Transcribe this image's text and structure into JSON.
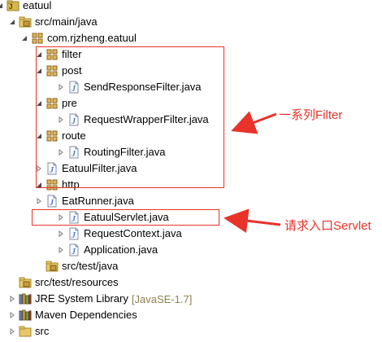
{
  "tree": [
    {
      "label": "eatuul",
      "icon": "project-icon",
      "toggle": "expanded",
      "interactable": true
    },
    {
      "label": "src/main/java",
      "icon": "source-folder-icon",
      "toggle": "expanded",
      "interactable": true
    },
    {
      "label": "com.rjzheng.eatuul",
      "icon": "package-icon",
      "toggle": "expanded",
      "interactable": true
    },
    {
      "label": "filter",
      "icon": "package-icon",
      "toggle": "expanded",
      "interactable": true
    },
    {
      "label": "post",
      "icon": "package-icon",
      "toggle": "expanded",
      "interactable": true
    },
    {
      "label": "SendResponseFilter.java",
      "icon": "java-file-icon",
      "toggle": "collapsed",
      "interactable": true
    },
    {
      "label": "pre",
      "icon": "package-icon",
      "toggle": "expanded",
      "interactable": true
    },
    {
      "label": "RequestWrapperFilter.java",
      "icon": "java-file-icon",
      "toggle": "collapsed",
      "interactable": true
    },
    {
      "label": "route",
      "icon": "package-icon",
      "toggle": "expanded",
      "interactable": true
    },
    {
      "label": "RoutingFilter.java",
      "icon": "java-file-icon",
      "toggle": "collapsed",
      "interactable": true
    },
    {
      "label": "EatuulFilter.java",
      "icon": "java-file-icon",
      "toggle": "collapsed",
      "interactable": true
    },
    {
      "label": "http",
      "icon": "package-icon",
      "toggle": "expanded",
      "interactable": true
    },
    {
      "label": "EatRunner.java",
      "icon": "java-file-icon",
      "toggle": "collapsed",
      "interactable": true
    },
    {
      "label": "EatuulServlet.java",
      "icon": "java-file-icon",
      "toggle": "collapsed",
      "interactable": true
    },
    {
      "label": "RequestContext.java",
      "icon": "java-file-icon",
      "toggle": "collapsed",
      "interactable": true
    },
    {
      "label": "Application.java",
      "icon": "java-file-icon",
      "toggle": "collapsed",
      "interactable": true
    },
    {
      "label": "src/test/java",
      "icon": "source-folder-icon",
      "toggle": "none",
      "interactable": true
    },
    {
      "label": "src/test/resources",
      "icon": "source-folder-icon",
      "toggle": "none",
      "interactable": true
    },
    {
      "label": "JRE System Library",
      "icon": "library-icon",
      "toggle": "collapsed",
      "decoration": "[JavaSE-1.7]",
      "interactable": true
    },
    {
      "label": "Maven Dependencies",
      "icon": "library-icon",
      "toggle": "collapsed",
      "interactable": true
    },
    {
      "label": "src",
      "icon": "folder-icon",
      "toggle": "collapsed",
      "interactable": true
    }
  ],
  "annotations": {
    "filter_label": "一系列Filter",
    "servlet_label": "请求入口Servlet",
    "color": "#e8332a"
  },
  "colors": {
    "package": "#b5892c",
    "java_file": "#4a78c0",
    "folder": "#d9b64a",
    "annotation": "#e8332a"
  }
}
